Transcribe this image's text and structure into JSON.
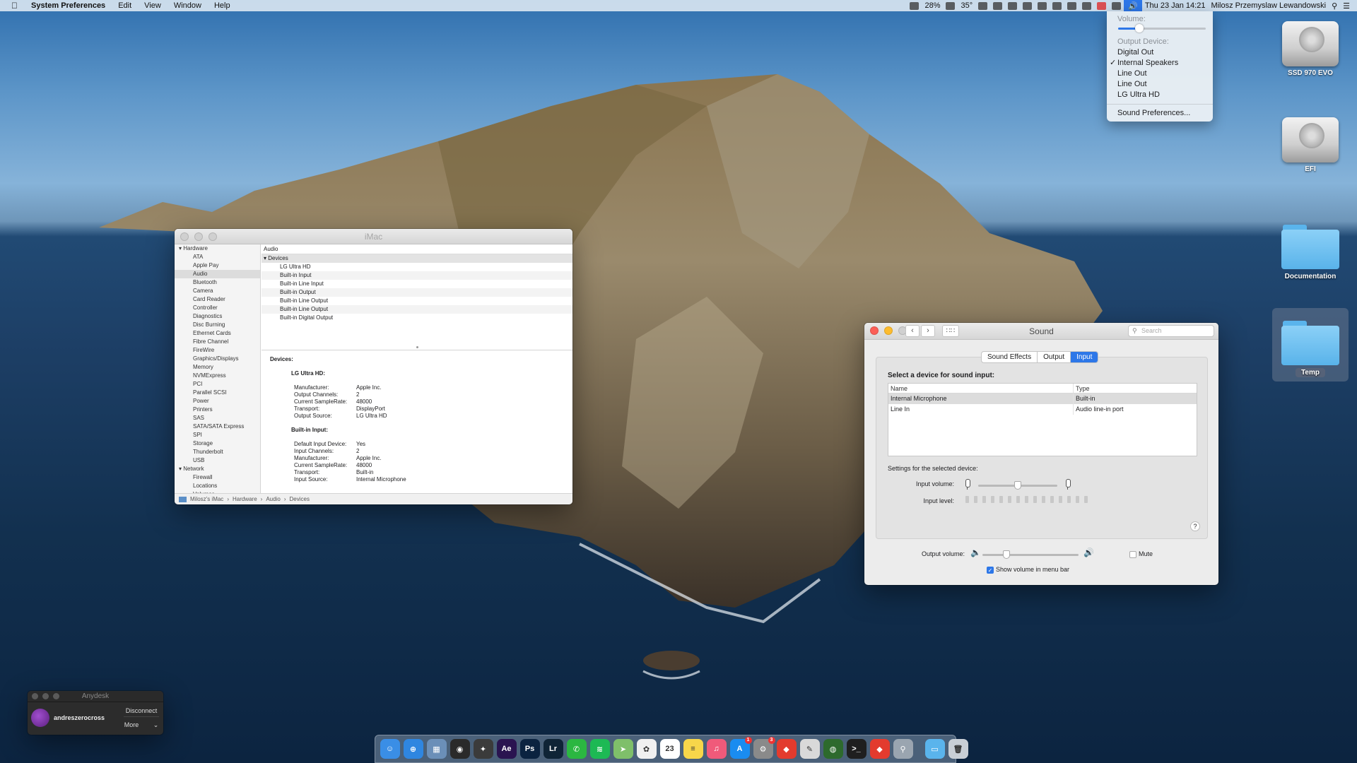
{
  "menubar": {
    "app_name": "System Preferences",
    "menus": [
      "Edit",
      "View",
      "Window",
      "Help"
    ],
    "status": {
      "battery": "28%",
      "temperature": "35°",
      "datetime": "Thu 23 Jan  14:21",
      "user": "Milosz Przemyslaw Lewandowski"
    }
  },
  "volume_menu": {
    "volume_label": "Volume:",
    "volume_level": 0.25,
    "output_header": "Output Device:",
    "options": [
      "Digital Out",
      "Internal Speakers",
      "Line Out",
      "Line Out",
      "LG Ultra HD"
    ],
    "checkmark": "✓",
    "selected_index": 1,
    "preferences": "Sound Preferences..."
  },
  "desktop_icons": [
    {
      "label": "SSD 970 EVO",
      "icon": "hard-drive-icon"
    },
    {
      "label": "EFI",
      "icon": "hard-drive-icon"
    },
    {
      "label": "Documentation",
      "icon": "folder-icon"
    },
    {
      "label": "Temp",
      "icon": "folder-icon"
    }
  ],
  "system_info": {
    "title": "iMac",
    "sidebar": [
      {
        "label": "Hardware",
        "group": true
      },
      {
        "label": "ATA"
      },
      {
        "label": "Apple Pay"
      },
      {
        "label": "Audio",
        "selected": true
      },
      {
        "label": "Bluetooth"
      },
      {
        "label": "Camera"
      },
      {
        "label": "Card Reader"
      },
      {
        "label": "Controller"
      },
      {
        "label": "Diagnostics"
      },
      {
        "label": "Disc Burning"
      },
      {
        "label": "Ethernet Cards"
      },
      {
        "label": "Fibre Channel"
      },
      {
        "label": "FireWire"
      },
      {
        "label": "Graphics/Displays"
      },
      {
        "label": "Memory"
      },
      {
        "label": "NVMExpress"
      },
      {
        "label": "PCI"
      },
      {
        "label": "Parallel SCSI"
      },
      {
        "label": "Power"
      },
      {
        "label": "Printers"
      },
      {
        "label": "SAS"
      },
      {
        "label": "SATA/SATA Express"
      },
      {
        "label": "SPI"
      },
      {
        "label": "Storage"
      },
      {
        "label": "Thunderbolt"
      },
      {
        "label": "USB"
      },
      {
        "label": "Network",
        "group": true
      },
      {
        "label": "Firewall"
      },
      {
        "label": "Locations"
      },
      {
        "label": "Volumes"
      }
    ],
    "column_header": "Audio",
    "tree_group": "Devices",
    "tree_items": [
      "LG Ultra HD",
      "Built-in Input",
      "Built-in Line Input",
      "Built-in Output",
      "Built-in Line Output",
      "Built-in Line Output",
      "Built-in Digital Output"
    ],
    "detail": {
      "heading": "Devices:",
      "sections": [
        {
          "name": "LG Ultra HD:",
          "fields": [
            [
              "Manufacturer:",
              "Apple Inc."
            ],
            [
              "Output Channels:",
              "2"
            ],
            [
              "Current SampleRate:",
              "48000"
            ],
            [
              "Transport:",
              "DisplayPort"
            ],
            [
              "Output Source:",
              "LG Ultra HD"
            ]
          ]
        },
        {
          "name": "Built-in Input:",
          "fields": [
            [
              "Default Input Device:",
              "Yes"
            ],
            [
              "Input Channels:",
              "2"
            ],
            [
              "Manufacturer:",
              "Apple Inc."
            ],
            [
              "Current SampleRate:",
              "48000"
            ],
            [
              "Transport:",
              "Built-in"
            ],
            [
              "Input Source:",
              "Internal Microphone"
            ]
          ]
        }
      ]
    },
    "path": [
      "Milosz's iMac",
      "Hardware",
      "Audio",
      "Devices"
    ],
    "path_sep": "›"
  },
  "sound": {
    "title": "Sound",
    "search_placeholder": "Search",
    "tabs": [
      "Sound Effects",
      "Output",
      "Input"
    ],
    "active_tab": 2,
    "prompt": "Select a device for sound input:",
    "columns": [
      "Name",
      "Type"
    ],
    "devices": [
      {
        "name": "Internal Microphone",
        "type": "Built-in",
        "selected": true
      },
      {
        "name": "Line In",
        "type": "Audio line-in port"
      }
    ],
    "settings_label": "Settings for the selected device:",
    "input_volume_label": "Input volume:",
    "input_volume": 0.5,
    "input_level_label": "Input level:",
    "help": "?",
    "output_volume_label": "Output volume:",
    "output_volume": 0.25,
    "mute_label": "Mute",
    "mute_checked": false,
    "show_volume_label": "Show volume in menu bar",
    "show_volume_checked": true
  },
  "anydesk": {
    "title": "Anydesk",
    "user": "andreszerocross",
    "disconnect": "Disconnect",
    "more": "More"
  },
  "dock": {
    "items": [
      {
        "name": "finder",
        "color": "#3a8ee6",
        "glyph": "☺"
      },
      {
        "name": "safari",
        "color": "#2f86e0",
        "glyph": "⊕"
      },
      {
        "name": "preview",
        "color": "#6b8fb8",
        "glyph": "▦"
      },
      {
        "name": "davinci-resolve",
        "color": "#2a2a2a",
        "glyph": "◉"
      },
      {
        "name": "final-cut-pro",
        "color": "#3b3b3b",
        "glyph": "✦"
      },
      {
        "name": "after-effects",
        "color": "#2a1450",
        "glyph": "Ae"
      },
      {
        "name": "photoshop",
        "color": "#0b2340",
        "glyph": "Ps"
      },
      {
        "name": "lightroom",
        "color": "#0f2436",
        "glyph": "Lr"
      },
      {
        "name": "whatsapp",
        "color": "#2bb741",
        "glyph": "✆"
      },
      {
        "name": "spotify",
        "color": "#1db954",
        "glyph": "≋"
      },
      {
        "name": "maps",
        "color": "#7fbf6a",
        "glyph": "➤"
      },
      {
        "name": "photos",
        "color": "#f0f0f0",
        "glyph": "✿"
      },
      {
        "name": "calendar",
        "color": "#ffffff",
        "glyph": "23"
      },
      {
        "name": "notes",
        "color": "#f7d64a",
        "glyph": "≡"
      },
      {
        "name": "music",
        "color": "#f05a7a",
        "glyph": "♫"
      },
      {
        "name": "app-store",
        "color": "#1a8cf0",
        "glyph": "A",
        "badge": "1"
      },
      {
        "name": "system-preferences",
        "color": "#8a8a8a",
        "glyph": "⚙",
        "badge": "3"
      },
      {
        "name": "anydesk",
        "color": "#e33b2e",
        "glyph": "◆"
      },
      {
        "name": "textedit",
        "color": "#d9d9d9",
        "glyph": "✎"
      },
      {
        "name": "activity-monitor",
        "color": "#2d6a2d",
        "glyph": "◍"
      },
      {
        "name": "terminal",
        "color": "#1f1f1f",
        "glyph": ">_"
      },
      {
        "name": "teamviewer",
        "color": "#e33b2e",
        "glyph": "◆"
      },
      {
        "name": "keychain",
        "color": "#9aa5b0",
        "glyph": "⚲"
      },
      {
        "name": "downloads-folder",
        "color": "#5ab4ec",
        "glyph": "▭",
        "after_sep": true
      },
      {
        "name": "trash",
        "color": "#c9cfd6",
        "glyph": "🗑"
      }
    ]
  }
}
